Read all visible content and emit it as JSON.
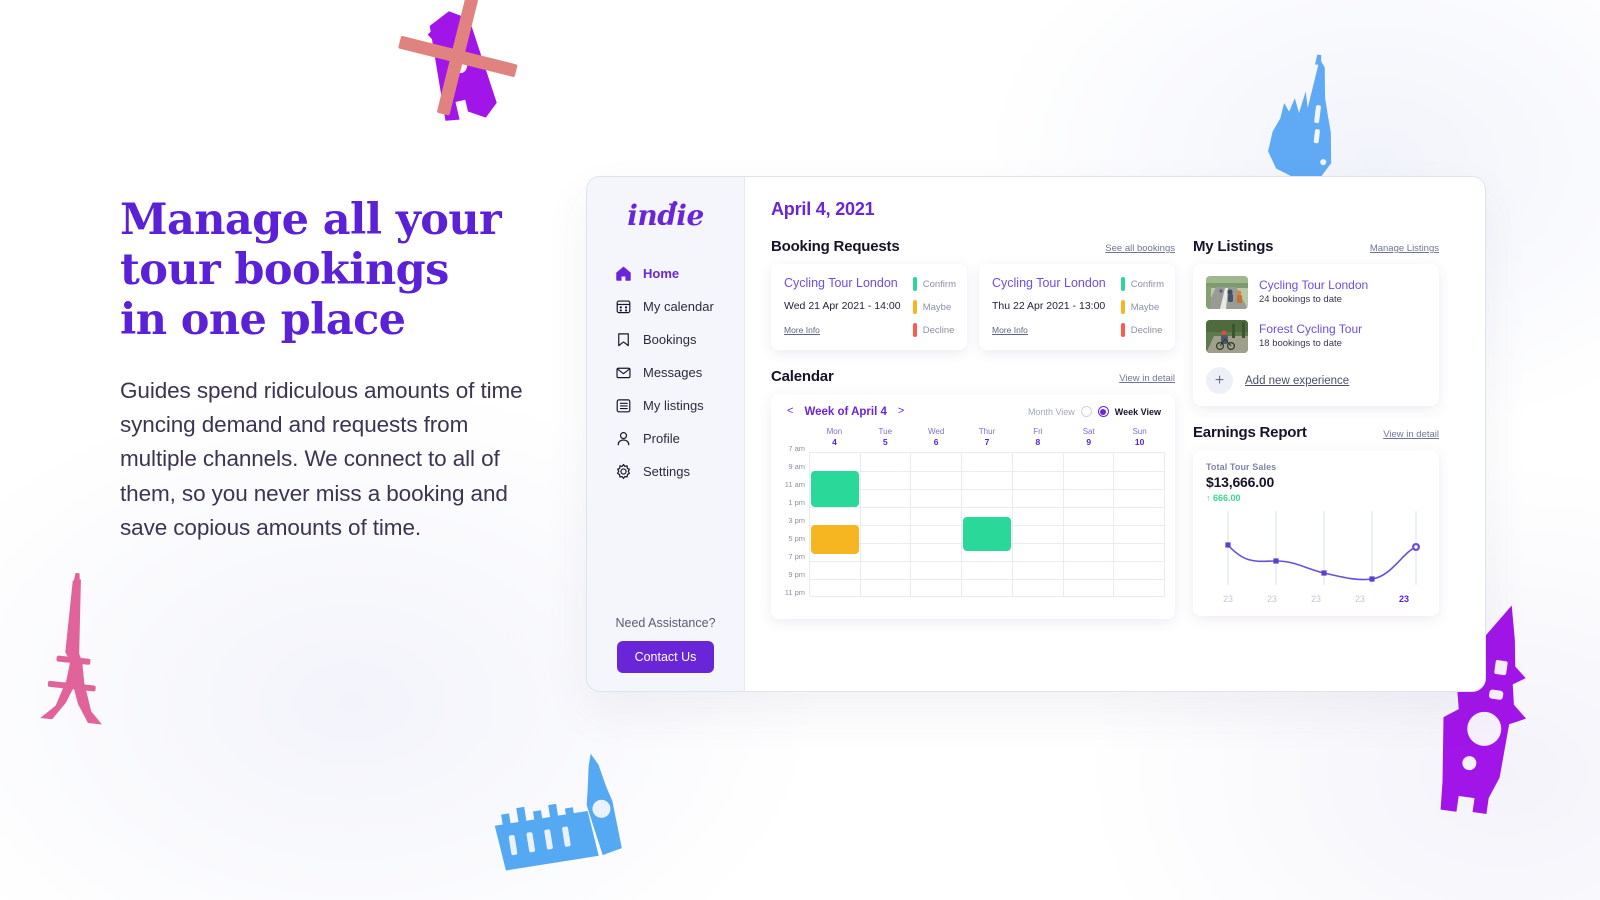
{
  "marketing": {
    "headline_lines": [
      "Manage all your",
      "tour bookings",
      "in one place"
    ],
    "body": "Guides spend ridiculous amounts of time syncing demand and requests from multiple channels. We connect to all of them, so you never miss a booking and save copious amounts of time."
  },
  "sidebar": {
    "brand": "indie",
    "items": [
      {
        "label": "Home",
        "icon": "home-icon",
        "active": true
      },
      {
        "label": "My calendar",
        "icon": "calendar-icon",
        "active": false
      },
      {
        "label": "Bookings",
        "icon": "bookmark-icon",
        "active": false
      },
      {
        "label": "Messages",
        "icon": "envelope-icon",
        "active": false
      },
      {
        "label": "My listings",
        "icon": "list-icon",
        "active": false
      },
      {
        "label": "Profile",
        "icon": "person-icon",
        "active": false
      },
      {
        "label": "Settings",
        "icon": "gear-icon",
        "active": false
      }
    ],
    "assistance_text": "Need Assistance?",
    "contact_button": "Contact Us"
  },
  "main": {
    "page_date": "April 4, 2021"
  },
  "booking_requests": {
    "title": "Booking Requests",
    "see_all_link": "See all bookings",
    "action_labels": [
      "Confirm",
      "Maybe",
      "Decline"
    ],
    "action_colors": [
      "#2ad89a",
      "#f5b621",
      "#fb5a4b"
    ],
    "more_info_label": "More Info",
    "cards": [
      {
        "title": "Cycling Tour London",
        "when": "Wed 21 Apr 2021 - 14:00"
      },
      {
        "title": "Cycling Tour London",
        "when": "Thu 22 Apr 2021 - 13:00"
      }
    ]
  },
  "calendar": {
    "title": "Calendar",
    "view_link": "View in detail",
    "prev_arrow": "<",
    "next_arrow": ">",
    "week_label": "Week of April 4",
    "month_view_label": "Month View",
    "week_view_label": "Week View",
    "selected_view": "week",
    "days": [
      {
        "name": "Mon",
        "num": "4"
      },
      {
        "name": "Tue",
        "num": "5"
      },
      {
        "name": "Wed",
        "num": "6"
      },
      {
        "name": "Thur",
        "num": "7"
      },
      {
        "name": "Fri",
        "num": "8"
      },
      {
        "name": "Sat",
        "num": "9"
      },
      {
        "name": "Sun",
        "num": "10"
      }
    ],
    "times": [
      "7 am",
      "9 am",
      "11 am",
      "1 pm",
      "3 pm",
      "5 pm",
      "7 pm",
      "9 pm",
      "11 pm"
    ],
    "events": [
      {
        "day_index": 0,
        "start_row": 1,
        "row_span": 2,
        "color": "#2ad89a"
      },
      {
        "day_index": 0,
        "start_row": 4,
        "row_span": 1.6,
        "color": "#f5b621"
      },
      {
        "day_index": 3,
        "start_row": 3.6,
        "row_span": 1.9,
        "color": "#2ad89a"
      }
    ]
  },
  "listings": {
    "title": "My Listings",
    "manage_link": "Manage Listings",
    "add_label": "Add new experience",
    "add_icon": "plus-icon",
    "items": [
      {
        "name": "Cycling Tour London",
        "meta": "24 bookings to date",
        "thumb": "cyclists-road-photo"
      },
      {
        "name": "Forest Cycling Tour",
        "meta": "18 bookings to date",
        "thumb": "cyclist-forest-photo"
      }
    ]
  },
  "earnings": {
    "title": "Earnings Report",
    "view_link": "View in detail",
    "metric_label": "Total Tour Sales",
    "metric_value": "$13,666.00",
    "delta_value": "↑ 666.00",
    "delta_color": "#3dd68c"
  },
  "chart_data": {
    "type": "line",
    "title": "Total Tour Sales",
    "xlabel": "",
    "ylabel": "",
    "categories": [
      "23",
      "23",
      "23",
      "23",
      "23"
    ],
    "x": [
      0,
      1,
      2,
      3,
      4
    ],
    "values": [
      62,
      43,
      27,
      14,
      60
    ],
    "ylim": [
      0,
      100
    ],
    "grid": "vertical-ticks-only",
    "legend": "none",
    "line_color": "#6a4fd8",
    "marker_color": "#5b3fd0",
    "highlighted_index": 4,
    "annotations": [
      {
        "text": "$13,666.00",
        "role": "metric-value"
      },
      {
        "text": "↑ 666.00",
        "role": "delta"
      }
    ]
  },
  "decorations": [
    {
      "name": "windmill-doodle",
      "colors": [
        "#a215e8",
        "#e0827f"
      ]
    },
    {
      "name": "castle-doodle",
      "colors": [
        "#5fa9f5"
      ]
    },
    {
      "name": "eiffel-tower-doodle",
      "colors": [
        "#e0649a"
      ]
    },
    {
      "name": "big-ben-doodle",
      "colors": [
        "#55a8f2"
      ]
    },
    {
      "name": "clock-tower-doodle",
      "colors": [
        "#a215e8"
      ]
    }
  ]
}
